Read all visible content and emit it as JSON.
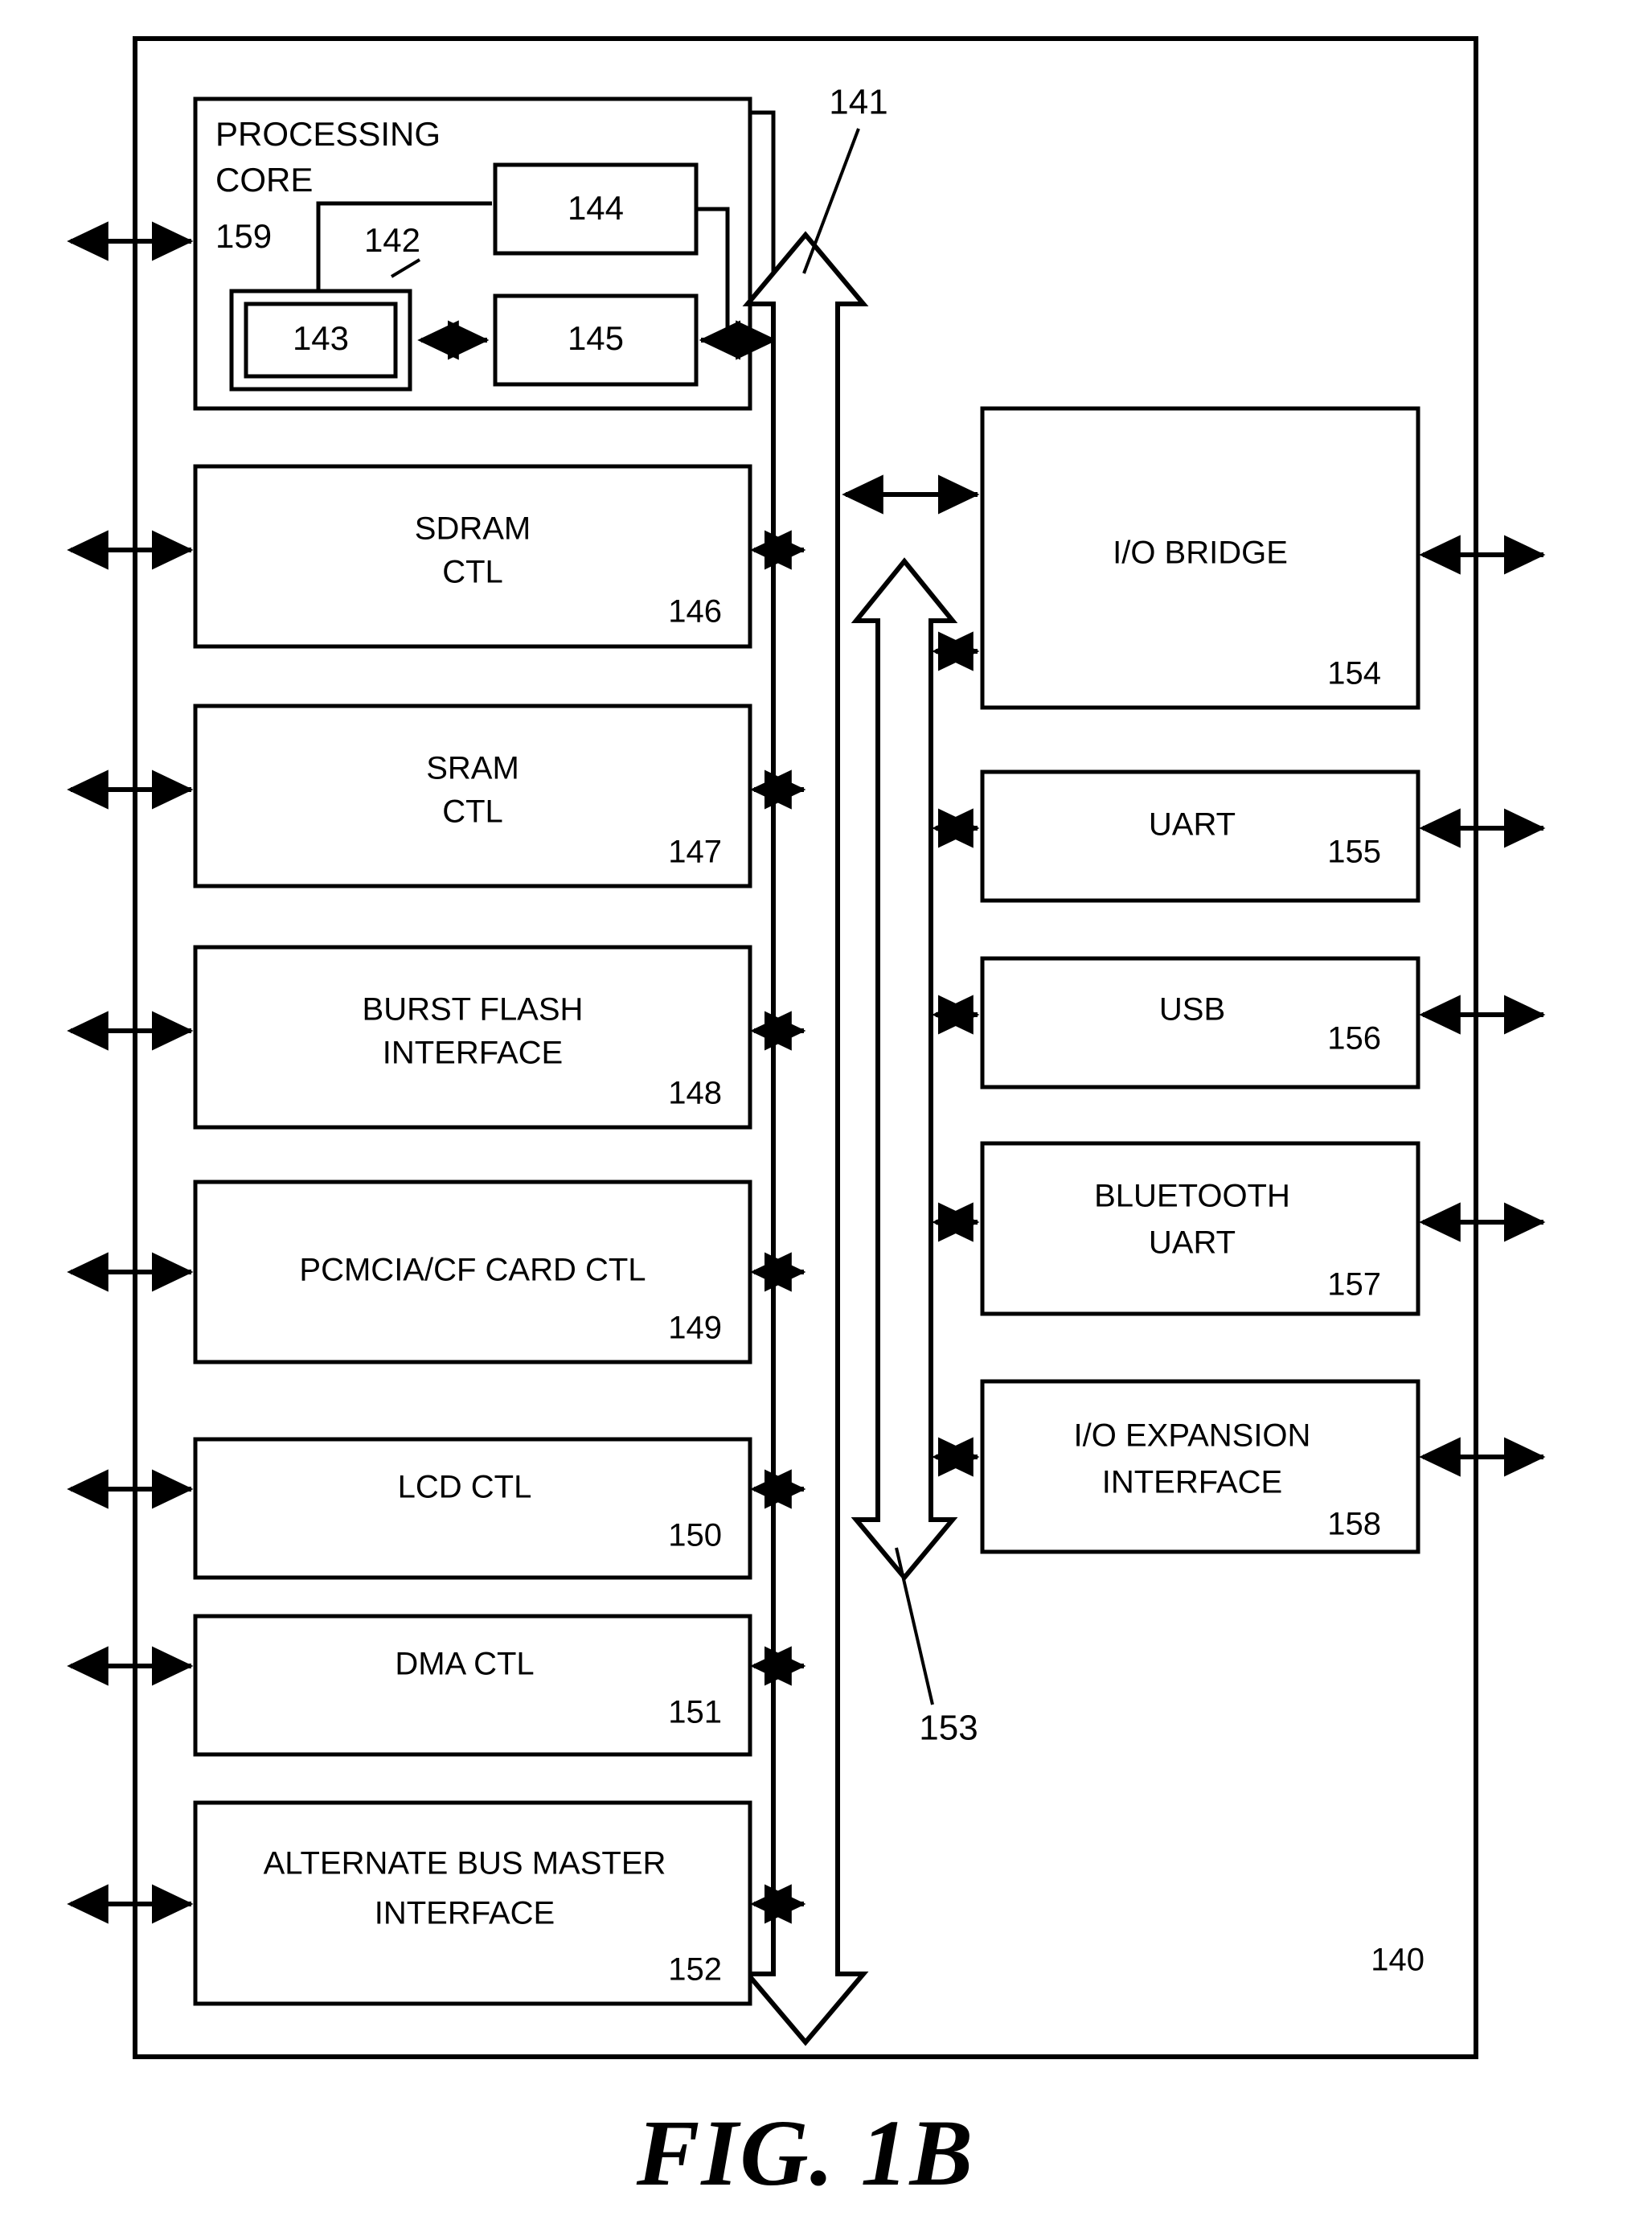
{
  "figure": {
    "caption": "FIG. 1B",
    "system_ref": "140",
    "outer_frame_name": "system-on-chip-boundary"
  },
  "processing_core": {
    "title_line1": "PROCESSING",
    "title_line2": "CORE",
    "ref": "159",
    "inner_blocks": [
      {
        "ref": "144",
        "name": "core-block-144"
      },
      {
        "ref": "145",
        "name": "core-block-145"
      },
      {
        "ref": "143",
        "name": "core-block-143"
      }
    ],
    "cache_ref": "142"
  },
  "buses": [
    {
      "ref": "141",
      "name": "main-bus-141",
      "direction": "bidirectional-vertical"
    },
    {
      "ref": "153",
      "name": "io-bus-153",
      "direction": "bidirectional-vertical"
    }
  ],
  "left_column": [
    {
      "label_lines": [
        "SDRAM",
        "CTL"
      ],
      "ref": "146",
      "name": "sdram-ctl-block"
    },
    {
      "label_lines": [
        "SRAM",
        "CTL"
      ],
      "ref": "147",
      "name": "sram-ctl-block"
    },
    {
      "label_lines": [
        "BURST FLASH",
        "INTERFACE"
      ],
      "ref": "148",
      "name": "burst-flash-interface-block"
    },
    {
      "label_lines": [
        "PCMCIA/CF CARD CTL"
      ],
      "ref": "149",
      "name": "pcmcia-cf-card-ctl-block"
    },
    {
      "label_lines": [
        "LCD CTL"
      ],
      "ref": "150",
      "name": "lcd-ctl-block"
    },
    {
      "label_lines": [
        "DMA CTL"
      ],
      "ref": "151",
      "name": "dma-ctl-block"
    },
    {
      "label_lines": [
        "ALTERNATE BUS MASTER",
        "INTERFACE"
      ],
      "ref": "152",
      "name": "alternate-bus-master-interface-block"
    }
  ],
  "right_column": [
    {
      "label_lines": [
        "I/O BRIDGE"
      ],
      "ref": "154",
      "name": "io-bridge-block"
    },
    {
      "label_lines": [
        "UART"
      ],
      "ref": "155",
      "name": "uart-block"
    },
    {
      "label_lines": [
        "USB"
      ],
      "ref": "156",
      "name": "usb-block"
    },
    {
      "label_lines": [
        "BLUETOOTH",
        "UART"
      ],
      "ref": "157",
      "name": "bluetooth-uart-block"
    },
    {
      "label_lines": [
        "I/O EXPANSION",
        "INTERFACE"
      ],
      "ref": "158",
      "name": "io-expansion-interface-block"
    }
  ],
  "colors": {
    "ink": "#000000",
    "paper": "#ffffff"
  }
}
